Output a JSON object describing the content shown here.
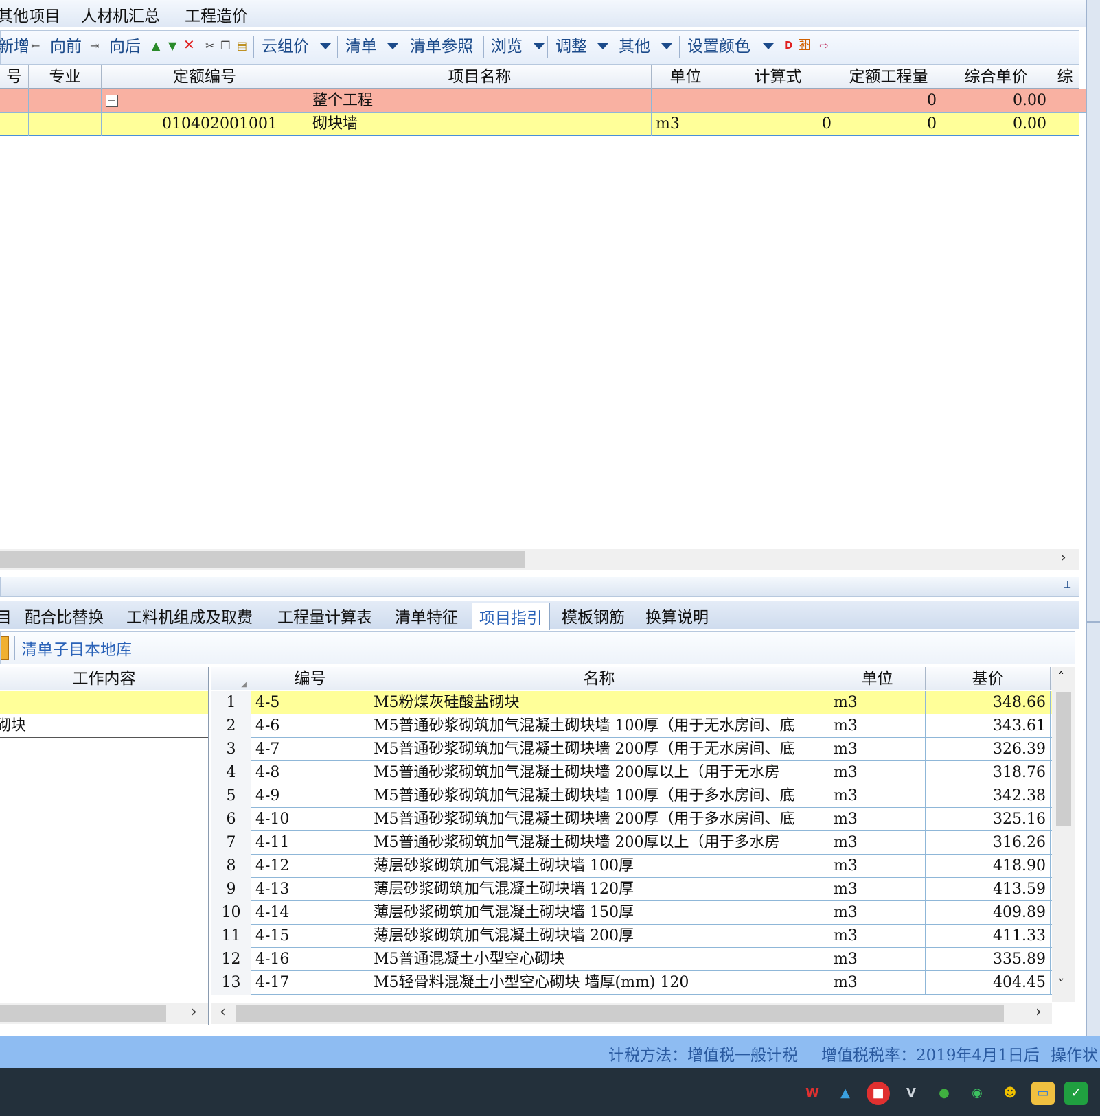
{
  "menu": [
    "其他项目",
    "人材机汇总",
    "工程造价"
  ],
  "toolbar": {
    "new": "新增",
    "forward": "向前",
    "backward": "向后",
    "cloud_price": "云组价",
    "bill": "清单",
    "bill_ref": "清单参照",
    "browse": "浏览",
    "adjust": "调整",
    "other": "其他",
    "set_color": "设置颜色"
  },
  "main_grid": {
    "headers": [
      "号",
      "专业",
      "定额编号",
      "项目名称",
      "单位",
      "计算式",
      "定额工程量",
      "综合单价",
      "综"
    ],
    "rows": [
      {
        "code": "",
        "name": "整个工程",
        "unit": "",
        "formula": "",
        "qty": "0",
        "price": "0.00"
      },
      {
        "code": "010402001001",
        "name": "砌块墙",
        "unit": "m3",
        "formula": "0",
        "qty": "0",
        "price": "0.00"
      }
    ],
    "collapse_symbol": "−"
  },
  "lower_tabs": [
    "目",
    "配合比替换",
    "工料机组成及取费",
    "工程量计算表",
    "清单特征",
    "项目指引",
    "模板钢筋",
    "换算说明"
  ],
  "active_lower_tab": "项目指引",
  "sub_toolbar": {
    "label": "清单子目本地库"
  },
  "work_content": {
    "header": "工作内容",
    "items": [
      "",
      "砌块"
    ]
  },
  "guide_grid": {
    "headers": [
      "编号",
      "名称",
      "单位",
      "基价"
    ],
    "rows": [
      {
        "no": "1",
        "code": "4-5",
        "name": "M5粉煤灰硅酸盐砌块",
        "unit": "m3",
        "price": "348.66"
      },
      {
        "no": "2",
        "code": "4-6",
        "name": "M5普通砂浆砌筑加气混凝土砌块墙 100厚（用于无水房间、底",
        "unit": "m3",
        "price": "343.61"
      },
      {
        "no": "3",
        "code": "4-7",
        "name": "M5普通砂浆砌筑加气混凝土砌块墙 200厚（用于无水房间、底",
        "unit": "m3",
        "price": "326.39"
      },
      {
        "no": "4",
        "code": "4-8",
        "name": "M5普通砂浆砌筑加气混凝土砌块墙 200厚以上（用于无水房",
        "unit": "m3",
        "price": "318.76"
      },
      {
        "no": "5",
        "code": "4-9",
        "name": "M5普通砂浆砌筑加气混凝土砌块墙 100厚（用于多水房间、底",
        "unit": "m3",
        "price": "342.38"
      },
      {
        "no": "6",
        "code": "4-10",
        "name": "M5普通砂浆砌筑加气混凝土砌块墙 200厚（用于多水房间、底",
        "unit": "m3",
        "price": "325.16"
      },
      {
        "no": "7",
        "code": "4-11",
        "name": "M5普通砂浆砌筑加气混凝土砌块墙 200厚以上（用于多水房",
        "unit": "m3",
        "price": "316.26"
      },
      {
        "no": "8",
        "code": "4-12",
        "name": "薄层砂浆砌筑加气混凝土砌块墙 100厚",
        "unit": "m3",
        "price": "418.90"
      },
      {
        "no": "9",
        "code": "4-13",
        "name": "薄层砂浆砌筑加气混凝土砌块墙 120厚",
        "unit": "m3",
        "price": "413.59"
      },
      {
        "no": "10",
        "code": "4-14",
        "name": "薄层砂浆砌筑加气混凝土砌块墙 150厚",
        "unit": "m3",
        "price": "409.89"
      },
      {
        "no": "11",
        "code": "4-15",
        "name": "薄层砂浆砌筑加气混凝土砌块墙 200厚",
        "unit": "m3",
        "price": "411.33"
      },
      {
        "no": "12",
        "code": "4-16",
        "name": "M5普通混凝土小型空心砌块",
        "unit": "m3",
        "price": "335.89"
      },
      {
        "no": "13",
        "code": "4-17",
        "name": "M5轻骨料混凝土小型空心砌块  墙厚(mm) 120",
        "unit": "m3",
        "price": "404.45"
      }
    ]
  },
  "status": {
    "tax_method": "计税方法：增值税一般计税",
    "tax_rate": "增值税税率：2019年4月1日后",
    "op_status": "操作状"
  },
  "colors": {
    "row_project": "#f9b1a2",
    "row_selected": "#ffff99",
    "accent": "#2a62b8"
  },
  "tray_icons": [
    "wps-icon",
    "triangle-icon",
    "record-icon",
    "v-icon",
    "browser-icon",
    "wechat-icon",
    "qq-icon",
    "folder-icon",
    "check-icon"
  ]
}
